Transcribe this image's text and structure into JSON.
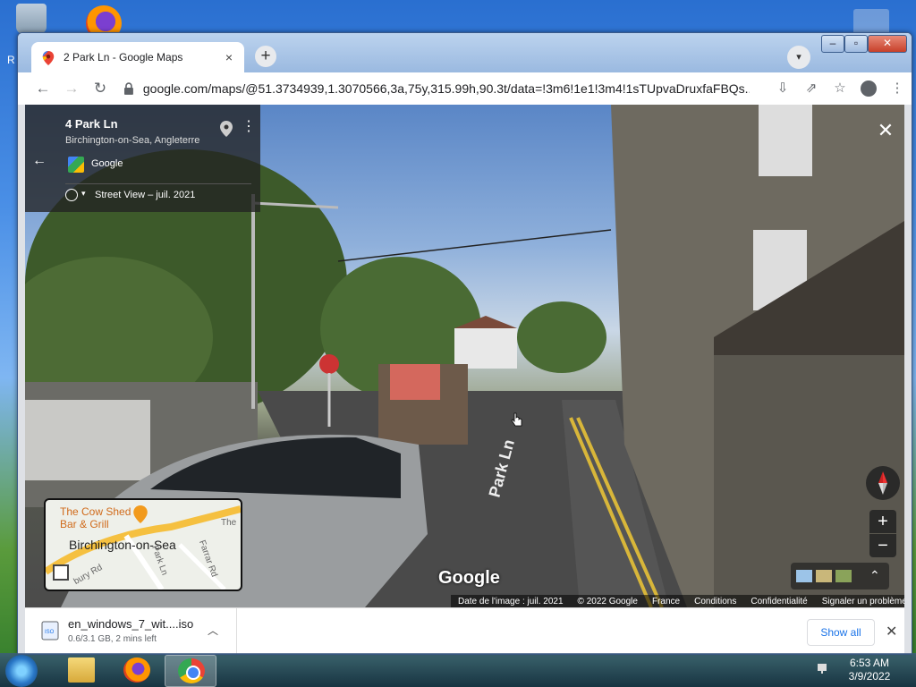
{
  "desktop": {
    "icon_label": "R"
  },
  "browser": {
    "tab": {
      "title": "2 Park Ln - Google Maps",
      "close": "×"
    },
    "new_tab": "+",
    "window_controls": {
      "minimize": "–",
      "maximize": "▫",
      "close": "✕"
    },
    "nav": {
      "back": "←",
      "forward": "→",
      "reload": "↻"
    },
    "url": "google.com/maps/@51.3734939,1.3070566,3a,75y,315.99h,90.3t/data=!3m6!1e1!3m4!1sTUpvaDruxfaFBQs...",
    "menu_dots": "⋮"
  },
  "streetview": {
    "place_title": "4 Park Ln",
    "place_subtitle": "Birchington-on-Sea, Angleterre",
    "provider": "Google",
    "capture_date": "Street View – juil. 2021",
    "close": "✕",
    "back": "←",
    "minimap": {
      "poi_line1": "The Cow Shed",
      "poi_line2": "Bar & Grill",
      "town": "Birchington-on-Sea",
      "roads": [
        "Park Ln",
        "Farrar Rd",
        "bury Rd",
        "The"
      ]
    },
    "zoom_in": "+",
    "zoom_out": "−",
    "watermark": "Google",
    "attribution": [
      "Date de l'image : juil. 2021",
      "© 2022 Google",
      "France",
      "Conditions",
      "Confidentialité",
      "Signaler un problème"
    ],
    "chevron": "⌃"
  },
  "download_bar": {
    "filename": "en_windows_7_wit....iso",
    "status": "0.6/3.1 GB, 2 mins left",
    "show_all": "Show all",
    "close": "✕"
  },
  "taskbar": {
    "time": "6:53 AM",
    "date": "3/9/2022"
  }
}
